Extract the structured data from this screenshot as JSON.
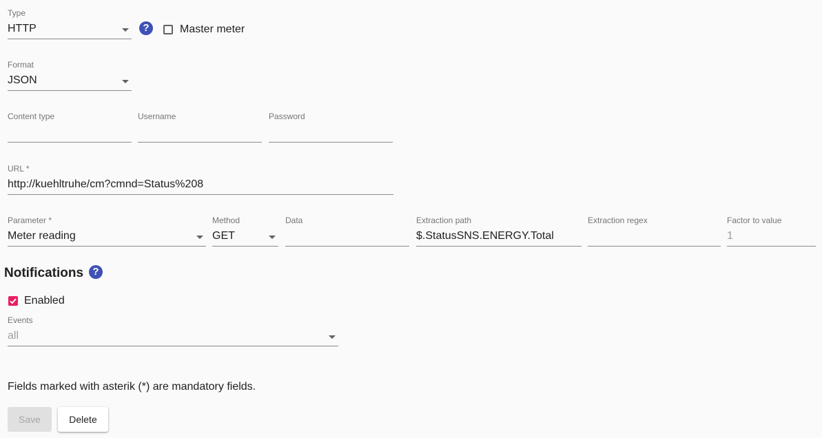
{
  "meter": {
    "type": {
      "label": "Type",
      "value": "HTTP"
    },
    "master_meter_label": "Master meter",
    "master_meter_checked": false,
    "format": {
      "label": "Format",
      "value": "JSON"
    },
    "content_type": {
      "label": "Content type",
      "value": ""
    },
    "username": {
      "label": "Username",
      "value": ""
    },
    "password": {
      "label": "Password",
      "value": ""
    },
    "url": {
      "label": "URL *",
      "value": "http://kuehltruhe/cm?cmnd=Status%208"
    },
    "parameter": {
      "label": "Parameter *",
      "value": "Meter reading"
    },
    "method": {
      "label": "Method",
      "value": "GET"
    },
    "data": {
      "label": "Data",
      "value": ""
    },
    "extraction_path": {
      "label": "Extraction path",
      "value": "$.StatusSNS.ENERGY.Total"
    },
    "extraction_regex": {
      "label": "Extraction regex",
      "value": ""
    },
    "factor": {
      "label": "Factor to value",
      "value": "1"
    }
  },
  "notifications": {
    "heading": "Notifications",
    "enabled_label": "Enabled",
    "enabled_checked": true,
    "events": {
      "label": "Events",
      "value": "all"
    }
  },
  "footer": {
    "mandatory_note": "Fields marked with asterik (*) are mandatory fields.",
    "save_label": "Save",
    "delete_label": "Delete"
  },
  "icons": {
    "help": "question-circle-icon",
    "dropdown": "caret-down-icon",
    "check": "check-icon"
  },
  "colors": {
    "help_icon": "#3f51b5",
    "checkbox_checked": "#e91e63"
  }
}
